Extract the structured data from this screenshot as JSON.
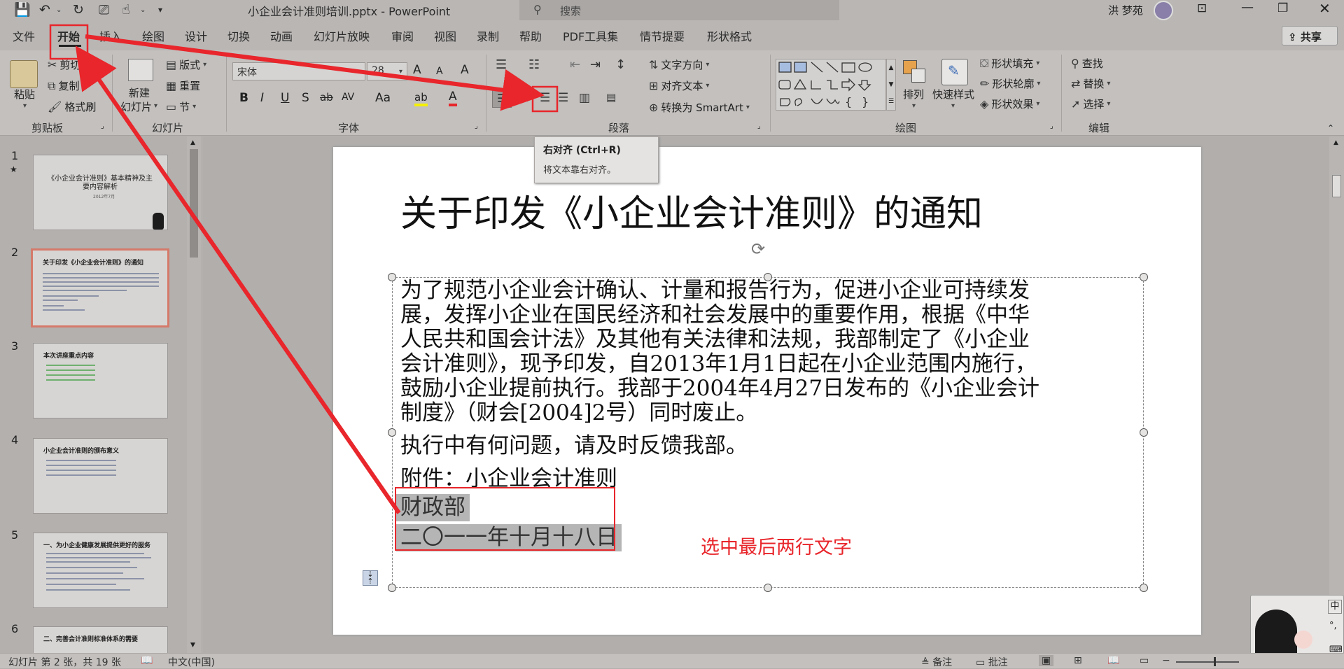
{
  "titlebar": {
    "filename": "小企业会计准则培训.pptx",
    "separator": "-",
    "app": "PowerPoint",
    "search_placeholder": "搜索",
    "user_name": "洪 梦苑"
  },
  "tabs": [
    "文件",
    "开始",
    "插入",
    "绘图",
    "设计",
    "切换",
    "动画",
    "幻灯片放映",
    "审阅",
    "视图",
    "录制",
    "帮助",
    "PDF工具集",
    "情节提要",
    "形状格式"
  ],
  "share_label": "共享",
  "ribbon": {
    "clipboard": {
      "paste": "粘贴",
      "cut": "剪切",
      "copy": "复制",
      "format_painter": "格式刷",
      "group": "剪贴板"
    },
    "slides": {
      "new_slide_1": "新建",
      "new_slide_2": "幻灯片",
      "layout": "版式",
      "reset": "重置",
      "section": "节",
      "group": "幻灯片"
    },
    "font": {
      "name": "宋体",
      "size": "28",
      "bold": "B",
      "italic": "I",
      "underline": "U",
      "shadow": "S",
      "strike": "ab",
      "spacing": "AV",
      "case": "Aa",
      "grow": "A",
      "shrink": "A",
      "clear": "A",
      "highlight": "ab",
      "color": "A",
      "group": "字体"
    },
    "paragraph": {
      "text_direction": "文字方向",
      "align_text": "对齐文本",
      "smartart": "转换为 SmartArt",
      "group": "段落"
    },
    "drawing": {
      "arrange": "排列",
      "quick_styles": "快速样式",
      "shape_fill": "形状填充",
      "shape_outline": "形状轮廓",
      "shape_effects": "形状效果",
      "group": "绘图"
    },
    "editing": {
      "find": "查找",
      "replace": "替换",
      "select": "选择",
      "group": "编辑"
    }
  },
  "tooltip": {
    "title": "右对齐 (Ctrl+R)",
    "desc": "将文本靠右对齐。"
  },
  "thumbnails": [
    {
      "num": "1",
      "star": "★",
      "title": "《小企业会计准则》基本精神及主要内容解析",
      "date": "2012年7月"
    },
    {
      "num": "2",
      "title": "关于印发《小企业会计准则》的通知"
    },
    {
      "num": "3",
      "title": "本次讲座重点内容"
    },
    {
      "num": "4",
      "title": "小企业会计准则的颁布意义"
    },
    {
      "num": "5",
      "title": "一、为小企业健康发展提供更好的服务"
    },
    {
      "num": "6",
      "title": "二、完善会计准则标准体系的需要"
    }
  ],
  "slide": {
    "title": "关于印发《小企业会计准则》的通知",
    "body_lines": [
      "为了规范小企业会计确认、计量和报告行为，促进小企业可持续发",
      "展，发挥小企业在国民经济和社会发展中的重要作用，根据《中华",
      "人民共和国会计法》及其他有关法律和法规，我部制定了《小企业",
      "会计准则》，现予印发，自2013年1月1日起在小企业范围内施行，",
      "鼓励小企业提前执行。我部于2004年4月27日发布的《小企业会计",
      "制度》（财会[2004]2号）同时废止。"
    ],
    "line2": "执行中有何问题，请及时反馈我部。",
    "line3": "附件：小企业会计准则",
    "sel1": "财政部",
    "sel2": "二〇一一年十月十八日"
  },
  "annotation": "选中最后两行文字",
  "statusbar": {
    "slide_info": "幻灯片 第 2 张，共 19 张",
    "language": "中文(中国)",
    "notes": "备注",
    "comments": "批注"
  },
  "ime": {
    "label": "中"
  },
  "colors": {
    "accent_red": "#e8262b",
    "ribbon_bg": "#c3c0be",
    "slide_bg": "#ffffff",
    "selection": "#b5b5b5"
  }
}
